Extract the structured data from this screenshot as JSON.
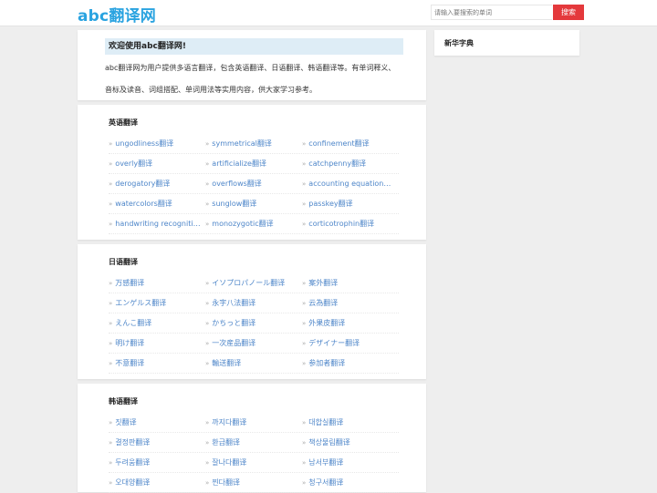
{
  "header": {
    "logo": "abc翻译网",
    "search_placeholder": "请输入要搜索的单词",
    "search_button": "搜索"
  },
  "welcome": {
    "title": "欢迎使用abc翻译网!",
    "line1": "abc翻译网为用户提供多语言翻译，包含英语翻译、日语翻译、韩语翻译等。有单词释义、",
    "line2": "音标及读音、词组搭配、单词用法等实用内容，供大家学习参考。"
  },
  "sidebar": {
    "title": "新华字典"
  },
  "sections": [
    {
      "title": "英语翻译",
      "rows": [
        [
          "ungodliness翻译",
          "symmetrical翻译",
          "confinement翻译"
        ],
        [
          "overly翻译",
          "artificialize翻译",
          "catchpenny翻译"
        ],
        [
          "derogatory翻译",
          "overflows翻译",
          "accounting equation翻译"
        ],
        [
          "watercolors翻译",
          "sunglow翻译",
          "passkey翻译"
        ],
        [
          "handwriting recognition...",
          "monozygotic翻译",
          "corticotrophin翻译"
        ]
      ]
    },
    {
      "title": "日语翻译",
      "rows": [
        [
          "万感翻译",
          "イソプロパノール翻译",
          "案外翻译"
        ],
        [
          "エンゲルス翻译",
          "永字八法翻译",
          "云為翻译"
        ],
        [
          "えんこ翻译",
          "かちっと翻译",
          "外果皮翻译"
        ],
        [
          "明け翻译",
          "一次産品翻译",
          "デザイナー翻译"
        ],
        [
          "不意翻译",
          "輸送翻译",
          "参加者翻译"
        ]
      ]
    },
    {
      "title": "韩语翻译",
      "rows": [
        [
          "짓翻译",
          "까지다翻译",
          "대합실翻译"
        ],
        [
          "결정판翻译",
          "환급翻译",
          "책상물림翻译"
        ],
        [
          "두려움翻译",
          "잘나다翻译",
          "남서부翻译"
        ],
        [
          "오대양翻译",
          "찐다翻译",
          "청구서翻译"
        ]
      ]
    }
  ]
}
